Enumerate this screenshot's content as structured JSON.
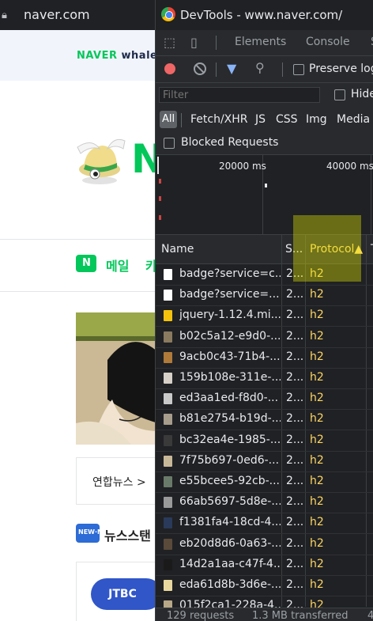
{
  "browser": {
    "url": "naver.com",
    "lock_icon": "lock-icon"
  },
  "naver": {
    "promo_naver": "NAVER",
    "promo_whale": " whale",
    "mail_label": "메일",
    "mail_extra": "카",
    "news_source": "연합뉴스 >",
    "newsstand_label": "뉴스스탠",
    "newsstand_badge": "NEW·N",
    "jtbc": "JTBC",
    "brand_color": "#03c75a"
  },
  "devtools": {
    "title": "DevTools - www.naver.com/",
    "tabs": [
      "Elements",
      "Console",
      "S"
    ],
    "preserve_log": "Preserve log",
    "filter_placeholder": "Filter",
    "hide_label": "Hide",
    "types": [
      "All",
      "Fetch/XHR",
      "JS",
      "CSS",
      "Img",
      "Media"
    ],
    "blocked_requests": "Blocked Requests",
    "overview_labels": [
      "20000 ms",
      "40000 ms"
    ],
    "columns": {
      "name": "Name",
      "status": "S...",
      "protocol": "Protocol▲",
      "extra": "T"
    },
    "rows": [
      {
        "name": "badge?service=c...",
        "status": "2...",
        "protocol": "h2",
        "icon": "#ffffff"
      },
      {
        "name": "badge?service=...",
        "status": "2...",
        "protocol": "h2",
        "icon": "#ffffff"
      },
      {
        "name": "jquery-1.12.4.mi...",
        "status": "2...",
        "protocol": "h2",
        "icon": "#f4c20d"
      },
      {
        "name": "b02c5a12-e9d0-...",
        "status": "2...",
        "protocol": "h2",
        "icon": "#8a7a60"
      },
      {
        "name": "9acb0c43-71b4-...",
        "status": "2...",
        "protocol": "h2",
        "icon": "#b07a3a"
      },
      {
        "name": "159b108e-311e-...",
        "status": "2...",
        "protocol": "h2",
        "icon": "#d6d0c8"
      },
      {
        "name": "ed3aa1ed-f8d0-...",
        "status": "2...",
        "protocol": "h2",
        "icon": "#c9c9c9"
      },
      {
        "name": "b81e2754-b19d-...",
        "status": "2...",
        "protocol": "h2",
        "icon": "#a89c8c"
      },
      {
        "name": "bc32ea4e-1985-...",
        "status": "2...",
        "protocol": "h2",
        "icon": "#3a3a3a"
      },
      {
        "name": "7f75b697-0ed6-...",
        "status": "2...",
        "protocol": "h2",
        "icon": "#c8b89a"
      },
      {
        "name": "e55bcee5-92cb-...",
        "status": "2...",
        "protocol": "h2",
        "icon": "#6a7a6a"
      },
      {
        "name": "66ab5697-5d8e-...",
        "status": "2...",
        "protocol": "h2",
        "icon": "#9a9a9a"
      },
      {
        "name": "f1381fa4-18cd-4...",
        "status": "2...",
        "protocol": "h2",
        "icon": "#2a3a5a"
      },
      {
        "name": "eb20d8d6-0a63-...",
        "status": "2...",
        "protocol": "h2",
        "icon": "#5a4a3a"
      },
      {
        "name": "14d2a1aa-c47f-4...",
        "status": "2...",
        "protocol": "h2",
        "icon": "#1a1a1a"
      },
      {
        "name": "eda61d8b-3d6e-...",
        "status": "2...",
        "protocol": "h2",
        "icon": "#e8d8a0"
      },
      {
        "name": "015f2ca1-228a-4...",
        "status": "2...",
        "protocol": "h2",
        "icon": "#b8a888"
      }
    ],
    "status_bar": [
      "129 requests",
      "1.3 MB transferred",
      "4"
    ]
  }
}
